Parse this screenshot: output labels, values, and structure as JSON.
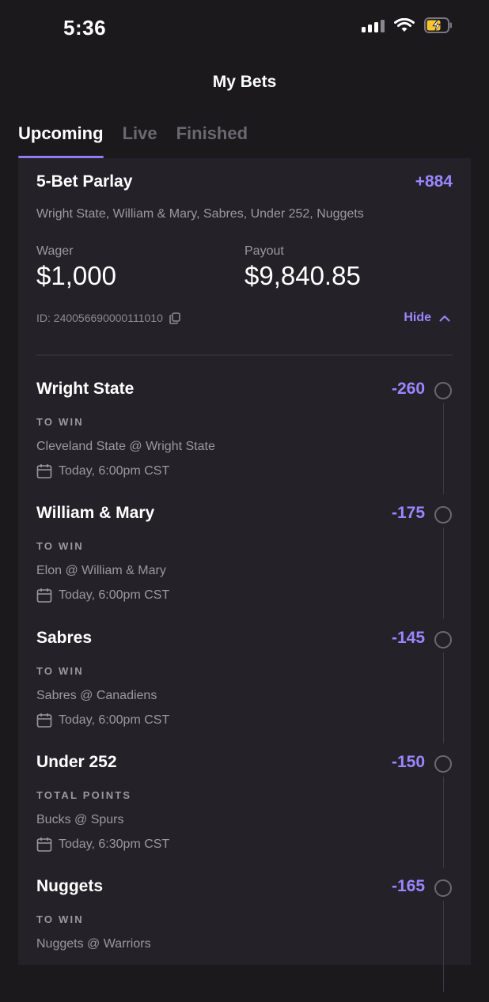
{
  "status_bar": {
    "time": "5:36"
  },
  "header": {
    "title": "My Bets"
  },
  "tabs": [
    {
      "label": "Upcoming",
      "active": true
    },
    {
      "label": "Live",
      "active": false
    },
    {
      "label": "Finished",
      "active": false
    }
  ],
  "parlay": {
    "title": "5-Bet Parlay",
    "odds": "+884",
    "legs_summary": "Wright State, William & Mary, Sabres, Under 252, Nuggets",
    "wager_label": "Wager",
    "wager_value": "$1,000",
    "payout_label": "Payout",
    "payout_value": "$9,840.85",
    "bet_id": "ID: 240056690000111010",
    "hide_label": "Hide"
  },
  "legs": [
    {
      "name": "Wright State",
      "odds": "-260",
      "type": "TO WIN",
      "matchup": "Cleveland State @ Wright State",
      "time": "Today, 6:00pm CST"
    },
    {
      "name": "William & Mary",
      "odds": "-175",
      "type": "TO WIN",
      "matchup": "Elon @ William & Mary",
      "time": "Today, 6:00pm CST"
    },
    {
      "name": "Sabres",
      "odds": "-145",
      "type": "TO WIN",
      "matchup": "Sabres @ Canadiens",
      "time": "Today, 6:00pm CST"
    },
    {
      "name": "Under 252",
      "odds": "-150",
      "type": "TOTAL POINTS",
      "matchup": "Bucks @ Spurs",
      "time": "Today, 6:30pm CST"
    },
    {
      "name": "Nuggets",
      "odds": "-165",
      "type": "TO WIN",
      "matchup": "Nuggets @ Warriors",
      "time": ""
    }
  ],
  "colors": {
    "accent": "#9a86ff",
    "background": "#1b191c",
    "card": "#242228",
    "muted": "#9b98a0"
  },
  "icons": [
    "signal-icon",
    "wifi-icon",
    "battery-charging-icon",
    "copy-icon",
    "chevron-up-icon",
    "calendar-icon",
    "radio-circle-icon"
  ]
}
